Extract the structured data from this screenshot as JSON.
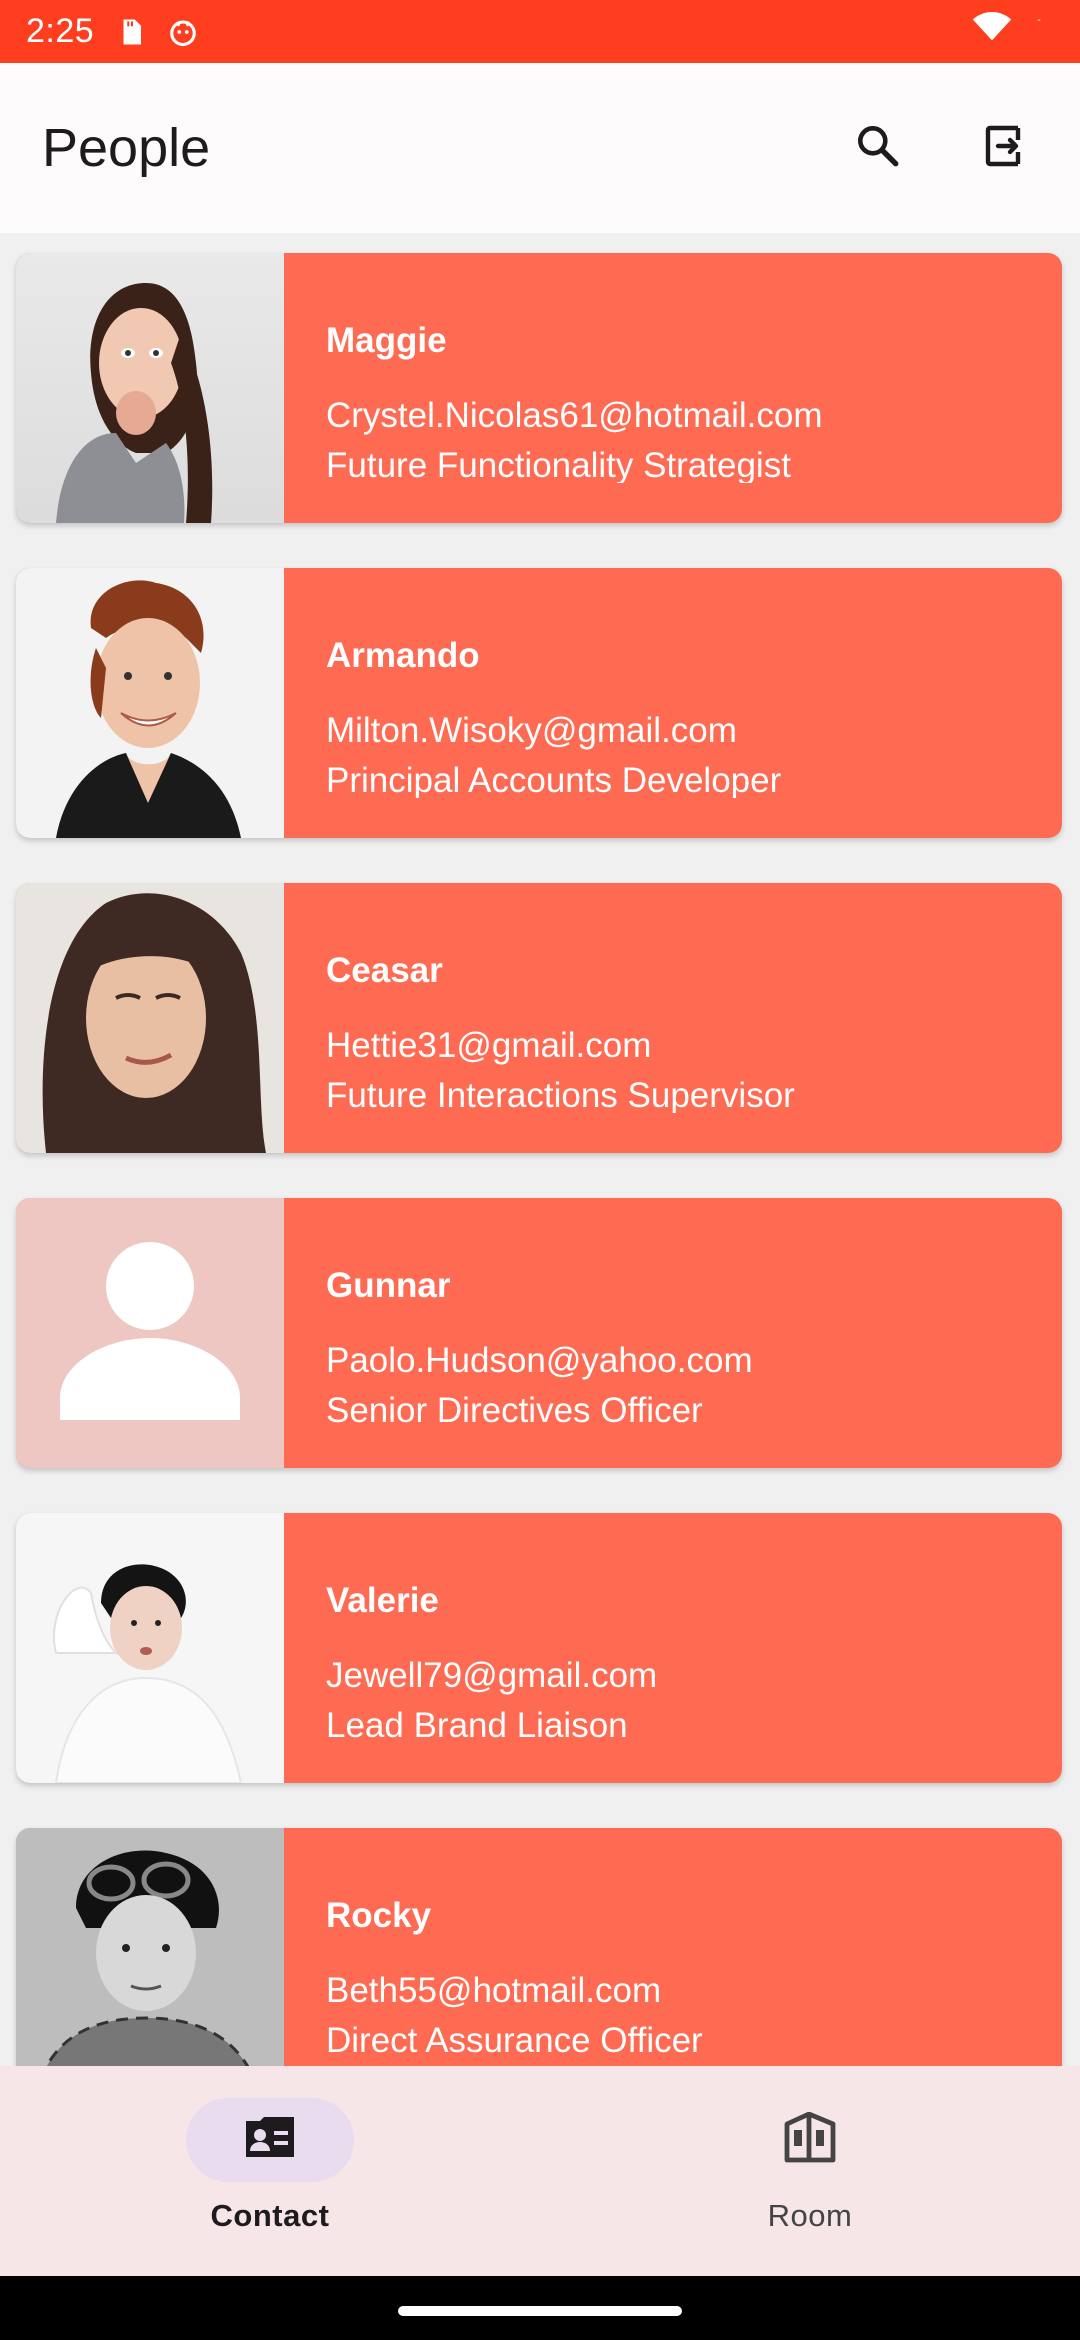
{
  "status_bar": {
    "time": "2:25",
    "icons": [
      "sd-card-icon",
      "android-icon"
    ],
    "right_icons": [
      "wifi-icon",
      "battery-icon"
    ]
  },
  "app_bar": {
    "title": "People",
    "actions": [
      "search-icon",
      "logout-icon"
    ]
  },
  "people": [
    {
      "name": "Maggie",
      "email": "Crystel.Nicolas61@hotmail.com",
      "title": "Future Functionality Strategist",
      "photo": "photo"
    },
    {
      "name": "Armando",
      "email": "Milton.Wisoky@gmail.com",
      "title": "Principal Accounts Developer",
      "photo": "photo"
    },
    {
      "name": "Ceasar",
      "email": "Hettie31@gmail.com",
      "title": "Future Interactions Supervisor",
      "photo": "photo"
    },
    {
      "name": "Gunnar",
      "email": "Paolo.Hudson@yahoo.com",
      "title": "Senior Directives Officer",
      "photo": "placeholder"
    },
    {
      "name": "Valerie",
      "email": "Jewell79@gmail.com",
      "title": "Lead Brand Liaison",
      "photo": "photo"
    },
    {
      "name": "Rocky",
      "email": "Beth55@hotmail.com",
      "title": "Direct Assurance Officer",
      "photo": "photo"
    }
  ],
  "bottom_nav": {
    "items": [
      {
        "label": "Contact",
        "icon": "contact-card-icon",
        "active": true
      },
      {
        "label": "Room",
        "icon": "room-building-icon",
        "active": false
      }
    ]
  },
  "colors": {
    "status_bar": "#ff3e20",
    "card": "#ff6a53",
    "placeholder_bg": "#eec6c2",
    "nav_bg": "#f6e6e7",
    "nav_active_pill": "#e9dcef"
  }
}
